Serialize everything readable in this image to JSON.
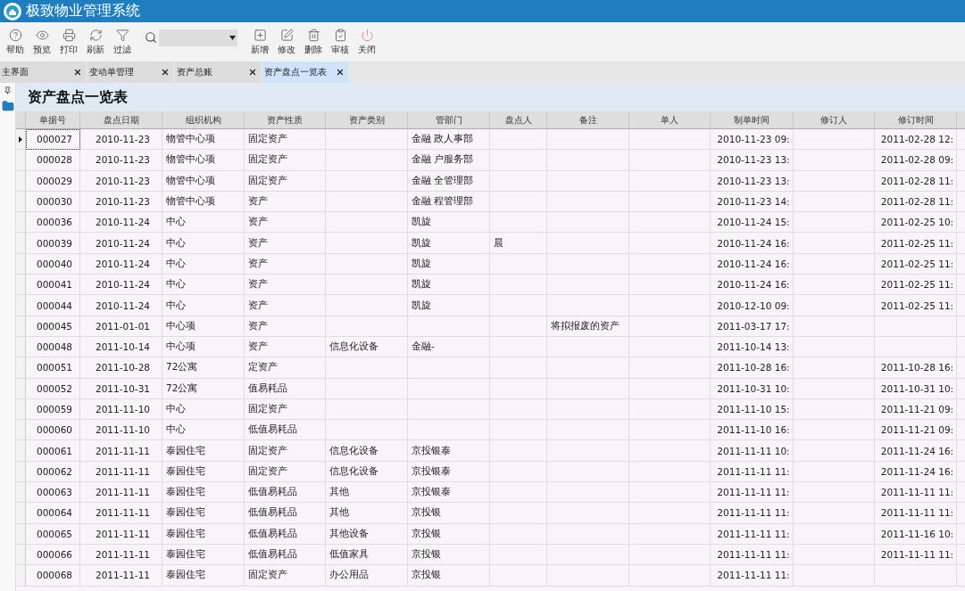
{
  "app": {
    "title": "极致物业管理系统"
  },
  "toolbar": [
    {
      "kind": "help",
      "label": "帮助"
    },
    {
      "kind": "preview",
      "label": "预览"
    },
    {
      "kind": "print",
      "label": "打印"
    },
    {
      "kind": "refresh",
      "label": "刷新"
    },
    {
      "kind": "filter",
      "label": "过滤"
    },
    {
      "kind": "search"
    },
    {
      "kind": "add",
      "label": "新增"
    },
    {
      "kind": "edit",
      "label": "修改"
    },
    {
      "kind": "delete",
      "label": "删除"
    },
    {
      "kind": "audit",
      "label": "审核"
    },
    {
      "kind": "close",
      "label": "关闭"
    }
  ],
  "tabs": [
    {
      "label": "主界面",
      "selected": false
    },
    {
      "label": "变动单管理",
      "selected": false
    },
    {
      "label": "资产总账",
      "selected": false
    },
    {
      "label": "资产盘点一览表",
      "selected": true
    }
  ],
  "page_title": "资产盘点一览表",
  "table": {
    "columns": [
      "单据号",
      "盘点日期",
      "组织机构",
      "资产性质",
      "资产类别",
      "管部门",
      "盘点人",
      "备注",
      "单人",
      "制单时间",
      "修订人",
      "修订时间"
    ],
    "rows": [
      {
        "selected": true,
        "cells": [
          "000027",
          "2010-11-23",
          "物管中心项",
          "固定资产",
          "",
          "金融 政人事部",
          "",
          "",
          "",
          "2010-11-23 09:",
          "",
          "2011-02-28 12:"
        ]
      },
      {
        "selected": false,
        "cells": [
          "000028",
          "2010-11-23",
          "物管中心项",
          "固定资产",
          "",
          "金融 户服务部",
          "",
          "",
          "",
          "2010-11-23 13:",
          "",
          "2011-02-28 09:"
        ]
      },
      {
        "selected": false,
        "cells": [
          "000029",
          "2010-11-23",
          "物管中心项",
          "固定资产",
          "",
          "金融 全管理部",
          "",
          "",
          "",
          "2010-11-23 13:",
          "",
          "2011-02-28 11:"
        ]
      },
      {
        "selected": false,
        "cells": [
          "000030",
          "2010-11-23",
          "物管中心项",
          "资产",
          "",
          "金融 程管理部",
          "",
          "",
          "",
          "2010-11-23 14:",
          "",
          "2011-02-28 11:"
        ]
      },
      {
        "selected": false,
        "cells": [
          "000036",
          "2010-11-24",
          "中心",
          "资产",
          "",
          "凯旋",
          "",
          "",
          "",
          "2010-11-24 15:",
          "",
          "2011-02-25 10:"
        ]
      },
      {
        "selected": false,
        "cells": [
          "000039",
          "2010-11-24",
          "中心",
          "资产",
          "",
          "凯旋",
          "晨",
          "",
          "",
          "2010-11-24 16:",
          "",
          "2011-02-25 11:"
        ]
      },
      {
        "selected": false,
        "cells": [
          "000040",
          "2010-11-24",
          "中心",
          "资产",
          "",
          "凯旋",
          "",
          "",
          "",
          "2010-11-24 16:",
          "",
          "2011-02-25 11:"
        ]
      },
      {
        "selected": false,
        "cells": [
          "000041",
          "2010-11-24",
          "中心",
          "资产",
          "",
          "凯旋",
          "",
          "",
          "",
          "2010-11-24 16:",
          "",
          "2011-02-25 11:"
        ]
      },
      {
        "selected": false,
        "cells": [
          "000044",
          "2010-11-24",
          "中心",
          "资产",
          "",
          "凯旋",
          "",
          "",
          "",
          "2010-12-10 09:",
          "",
          "2011-02-25 11:"
        ]
      },
      {
        "selected": false,
        "cells": [
          "000045",
          "2011-01-01",
          "中心项",
          "资产",
          "",
          "",
          "",
          "将拟报废的资产",
          "",
          "2011-03-17 17:",
          "",
          ""
        ]
      },
      {
        "selected": false,
        "cells": [
          "000048",
          "2011-10-14",
          "中心项",
          "资产",
          "信息化设备",
          "金融-",
          "",
          "",
          "",
          "2011-10-14 13:",
          "",
          ""
        ]
      },
      {
        "selected": false,
        "cells": [
          "000051",
          "2011-10-28",
          "72公寓",
          "定资产",
          "",
          "",
          "",
          "",
          "",
          "2011-10-28 16:",
          "",
          "2011-10-28 16:"
        ]
      },
      {
        "selected": false,
        "cells": [
          "000052",
          "2011-10-31",
          "72公寓",
          "值易耗品",
          "",
          "",
          "",
          "",
          "",
          "2011-10-31 10:",
          "",
          "2011-10-31 10:"
        ]
      },
      {
        "selected": false,
        "cells": [
          "000059",
          "2011-11-10",
          "中心",
          "固定资产",
          "",
          "",
          "",
          "",
          "",
          "2011-11-10 15:",
          "",
          "2011-11-21 09:"
        ]
      },
      {
        "selected": false,
        "cells": [
          "000060",
          "2011-11-10",
          "中心",
          "低值易耗品",
          "",
          "",
          "",
          "",
          "",
          "2011-11-10 16:",
          "",
          "2011-11-21 09:"
        ]
      },
      {
        "selected": false,
        "cells": [
          "000061",
          "2011-11-11",
          "泰园住宅",
          "固定资产",
          "信息化设备",
          "京投银泰",
          "",
          "",
          "",
          "2011-11-11 10:",
          "",
          "2011-11-24 16:"
        ]
      },
      {
        "selected": false,
        "cells": [
          "000062",
          "2011-11-11",
          "泰园住宅",
          "固定资产",
          "信息化设备",
          "京投银泰",
          "",
          "",
          "",
          "2011-11-11 11:",
          "",
          "2011-11-24 16:"
        ]
      },
      {
        "selected": false,
        "cells": [
          "000063",
          "2011-11-11",
          "泰园住宅",
          "低值易耗品",
          "其他",
          "京投银泰",
          "",
          "",
          "",
          "2011-11-11 11:",
          "",
          "2011-11-11 11:"
        ]
      },
      {
        "selected": false,
        "cells": [
          "000064",
          "2011-11-11",
          "泰园住宅",
          "低值易耗品",
          "其他",
          "京投银",
          "",
          "",
          "",
          "2011-11-11 11:",
          "",
          "2011-11-11 11:"
        ]
      },
      {
        "selected": false,
        "cells": [
          "000065",
          "2011-11-11",
          "泰园住宅",
          "低值易耗品",
          "其他设备",
          "京投银",
          "",
          "",
          "",
          "2011-11-11 11:",
          "",
          "2011-11-16 10:"
        ]
      },
      {
        "selected": false,
        "cells": [
          "000066",
          "2011-11-11",
          "泰园住宅",
          "低值易耗品",
          "低值家具",
          "京投银",
          "",
          "",
          "",
          "2011-11-11 11:",
          "",
          "2011-11-11 11:"
        ]
      },
      {
        "selected": false,
        "cells": [
          "000068",
          "2011-11-11",
          "泰园住宅",
          "固定资产",
          "办公用品",
          "京投银",
          "",
          "",
          "",
          "2011-11-11 11:",
          "",
          ""
        ]
      }
    ]
  }
}
